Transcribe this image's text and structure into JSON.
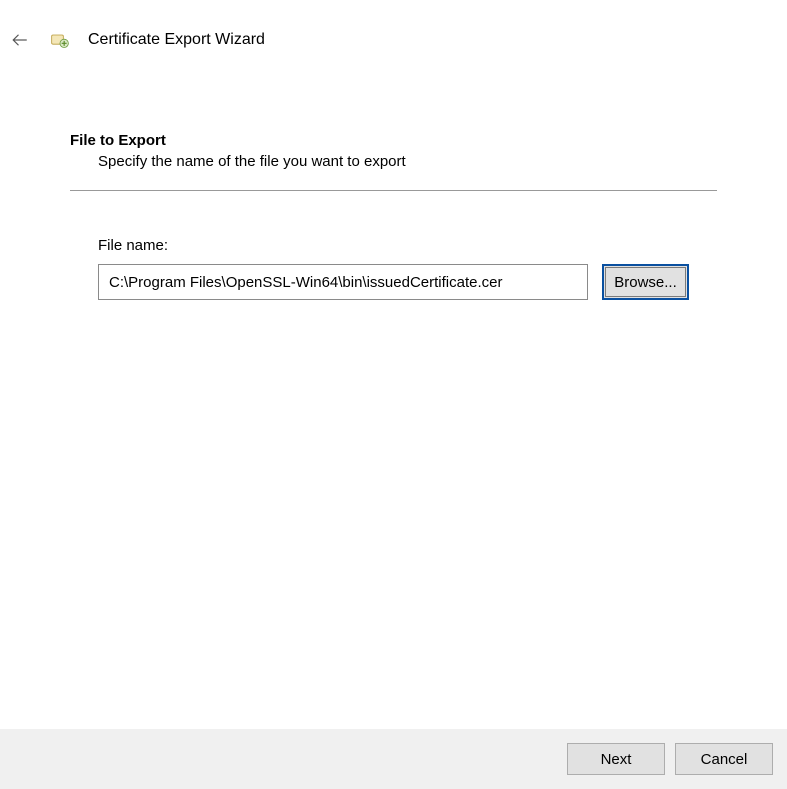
{
  "header": {
    "title": "Certificate Export Wizard"
  },
  "page": {
    "title": "File to Export",
    "subtitle": "Specify the name of the file you want to export"
  },
  "form": {
    "file_label": "File name:",
    "file_value": "C:\\Program Files\\OpenSSL-Win64\\bin\\issuedCertificate.cer",
    "browse_label": "Browse..."
  },
  "footer": {
    "next_label": "Next",
    "cancel_label": "Cancel"
  }
}
